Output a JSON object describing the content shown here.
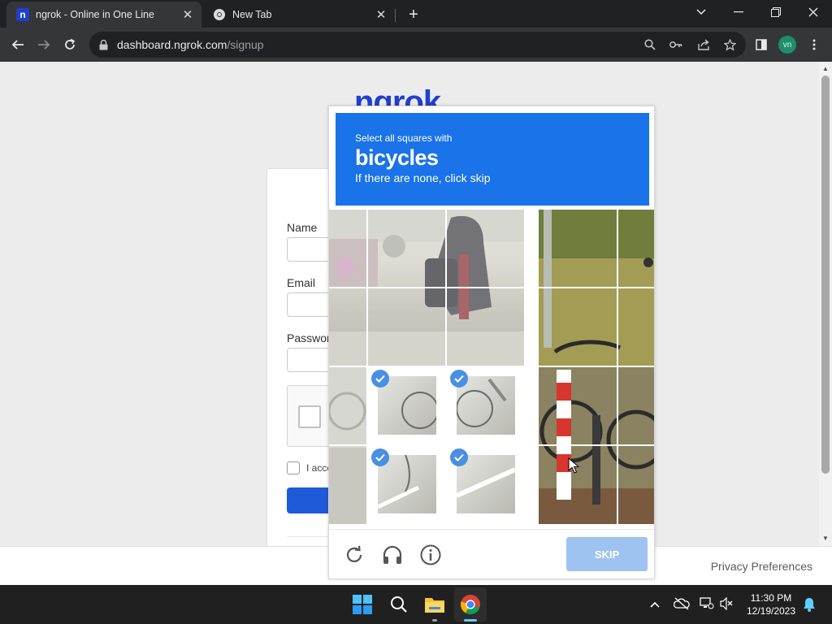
{
  "browser": {
    "tabs": [
      {
        "title": "ngrok - Online in One Line",
        "favicon": "ngrok-favicon-icon",
        "active": true
      },
      {
        "title": "New Tab",
        "favicon": "chrome-icon",
        "active": false
      }
    ],
    "url_host": "dashboard.ngrok.com",
    "url_path": "/signup",
    "profile_initials": "vn"
  },
  "page": {
    "logo": "ngrok",
    "fields": [
      {
        "label": "Name",
        "value": ""
      },
      {
        "label": "Email",
        "value": ""
      },
      {
        "label": "Passwor",
        "value": ""
      }
    ],
    "accept_text": "I acce",
    "privacy_link": "Privacy Preferences"
  },
  "captcha": {
    "prompt_small": "Select all squares with",
    "prompt_target": "bicycles",
    "prompt_sub": "If there are none, click skip",
    "selected_tiles": 4,
    "skip_label": "SKIP",
    "accent_color": "#1a73e8"
  },
  "taskbar": {
    "time": "11:30 PM",
    "date": "12/19/2023"
  }
}
